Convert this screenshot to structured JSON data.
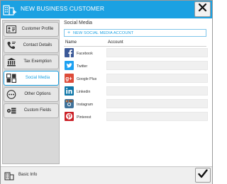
{
  "window": {
    "title": "NEW BUSINESS CUSTOMER",
    "title_icon": "business-building-add-icon",
    "close_icon": "close-icon"
  },
  "sidebar": {
    "items": [
      {
        "label": "Customer Profile",
        "icon": "id-card-icon",
        "active": false
      },
      {
        "label": "Contact Details",
        "icon": "contact-phone-icon",
        "active": false
      },
      {
        "label": "Tax Exemption",
        "icon": "bank-building-icon",
        "active": false
      },
      {
        "label": "Social Media",
        "icon": "social-grid-icon",
        "active": true
      },
      {
        "label": "Other Options",
        "icon": "more-options-icon",
        "active": false
      },
      {
        "label": "Custom Fields",
        "icon": "custom-fields-icon",
        "active": false
      }
    ]
  },
  "main": {
    "section_title": "Social Media",
    "add_button": {
      "icon": "+",
      "label": "NEW SOCIAL MEDIA ACCOUNT"
    },
    "columns": {
      "name": "Name",
      "account": "Account"
    },
    "rows": [
      {
        "name": "Facebook",
        "icon": "facebook-icon",
        "color": "#3b5998",
        "account": ""
      },
      {
        "name": "Twitter",
        "icon": "twitter-icon",
        "color": "#1da1f2",
        "account": ""
      },
      {
        "name": "Google Plus",
        "icon": "google-plus-icon",
        "color": "#dd4b39",
        "account": ""
      },
      {
        "name": "Linkedin",
        "icon": "linkedin-icon",
        "color": "#0e76a8",
        "account": ""
      },
      {
        "name": "Instagram",
        "icon": "instagram-icon",
        "color": "#3f729b",
        "account": ""
      },
      {
        "name": "Pinterest",
        "icon": "pinterest-icon",
        "color": "#cb2027",
        "account": ""
      }
    ]
  },
  "footer": {
    "basic_info_label": "Basic Info",
    "basic_info_icon": "business-building-icon",
    "confirm_icon": "checkmark-icon"
  },
  "colors": {
    "accent": "#1ba1e2",
    "sidebar_bg": "#d8d8d8",
    "field_bg": "#f0f0f0"
  }
}
